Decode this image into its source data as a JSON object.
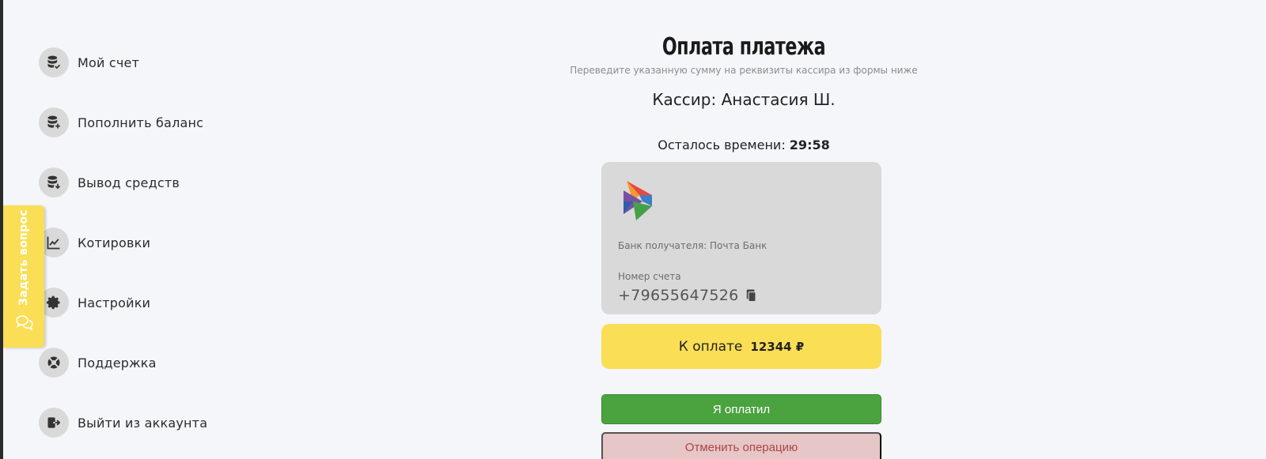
{
  "sidebar": {
    "items": [
      {
        "label": "Мой счет",
        "icon": "database-check-icon"
      },
      {
        "label": "Пополнить баланс",
        "icon": "database-plus-icon"
      },
      {
        "label": "Вывод средств",
        "icon": "database-download-icon"
      },
      {
        "label": "Котировки",
        "icon": "chart-line-icon"
      },
      {
        "label": "Настройки",
        "icon": "gear-icon"
      },
      {
        "label": "Поддержка",
        "icon": "lifebuoy-icon"
      },
      {
        "label": "Выйти из аккаунта",
        "icon": "logout-icon"
      }
    ]
  },
  "ask_tab": {
    "label": "Задать вопрос",
    "icon": "chat-bubbles-icon"
  },
  "main": {
    "title": "Оплата платежа",
    "subtitle": "Переведите указанную сумму на реквизиты кассира из формы ниже",
    "cashier": "Кассир: Анастасия Ш.",
    "timer_label": "Осталось времени:",
    "timer_value": "29:58"
  },
  "card": {
    "bank_logo": "pochta-bank-logo",
    "bank_label": "Банк получателя: Почта Банк",
    "account_label": "Номер счета",
    "account_number": "+79655647526",
    "copy_icon": "copy-icon"
  },
  "payment": {
    "label": "К оплате",
    "amount": "12344 ₽"
  },
  "buttons": {
    "paid": "Я оплатил",
    "cancel": "Отменить операцию"
  },
  "colors": {
    "accent_yellow": "#fade55",
    "paid_green": "#4aa33f",
    "cancel_bg": "#e6c6c6",
    "cancel_text": "#b04444",
    "card_bg": "#d9d9d9",
    "page_bg": "#f5f6fa"
  }
}
